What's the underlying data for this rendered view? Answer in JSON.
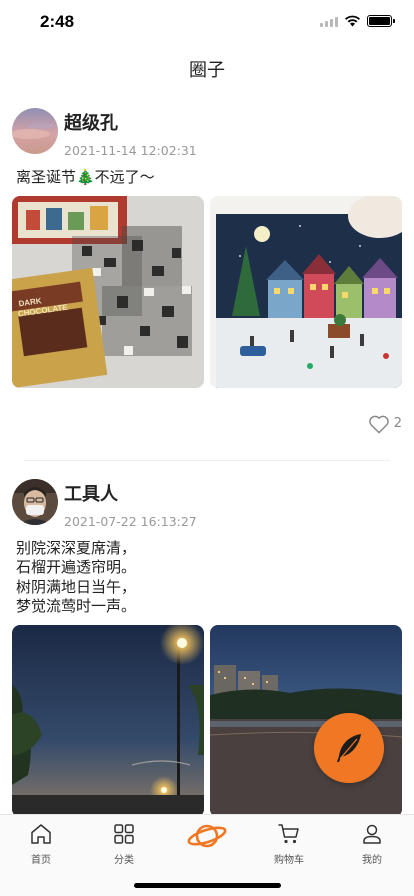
{
  "status_bar": {
    "time": "2:48",
    "icons": [
      "signal-icon",
      "wifi-icon",
      "battery-icon"
    ]
  },
  "header": {
    "title": "圈子"
  },
  "posts": [
    {
      "username": "超级孔",
      "timestamp": "2021-11-14 12:02:31",
      "text": "离圣诞节🎄不远了～",
      "images": [
        "jigsaw-puzzle-pieces-photo",
        "christmas-village-puzzle-photo"
      ],
      "likes": "2"
    },
    {
      "username": "工具人",
      "timestamp": "2021-07-22 16:13:27",
      "text": "别院深深夏席清，\n石榴开遍透帘明。\n树阴满地日当午，\n梦觉流莺时一声。",
      "images": [
        "evening-street-lamp-photo",
        "lakeside-dusk-photo"
      ]
    }
  ],
  "fab": {
    "icon": "feather-quill-icon",
    "color": "#f07825"
  },
  "tab_bar": {
    "items": [
      {
        "label": "首页",
        "icon": "home-icon"
      },
      {
        "label": "分类",
        "icon": "grid-icon"
      },
      {
        "label": "",
        "icon": "planet-icon"
      },
      {
        "label": "购物车",
        "icon": "cart-icon"
      },
      {
        "label": "我的",
        "icon": "user-icon"
      }
    ],
    "accent": "#f07825"
  }
}
